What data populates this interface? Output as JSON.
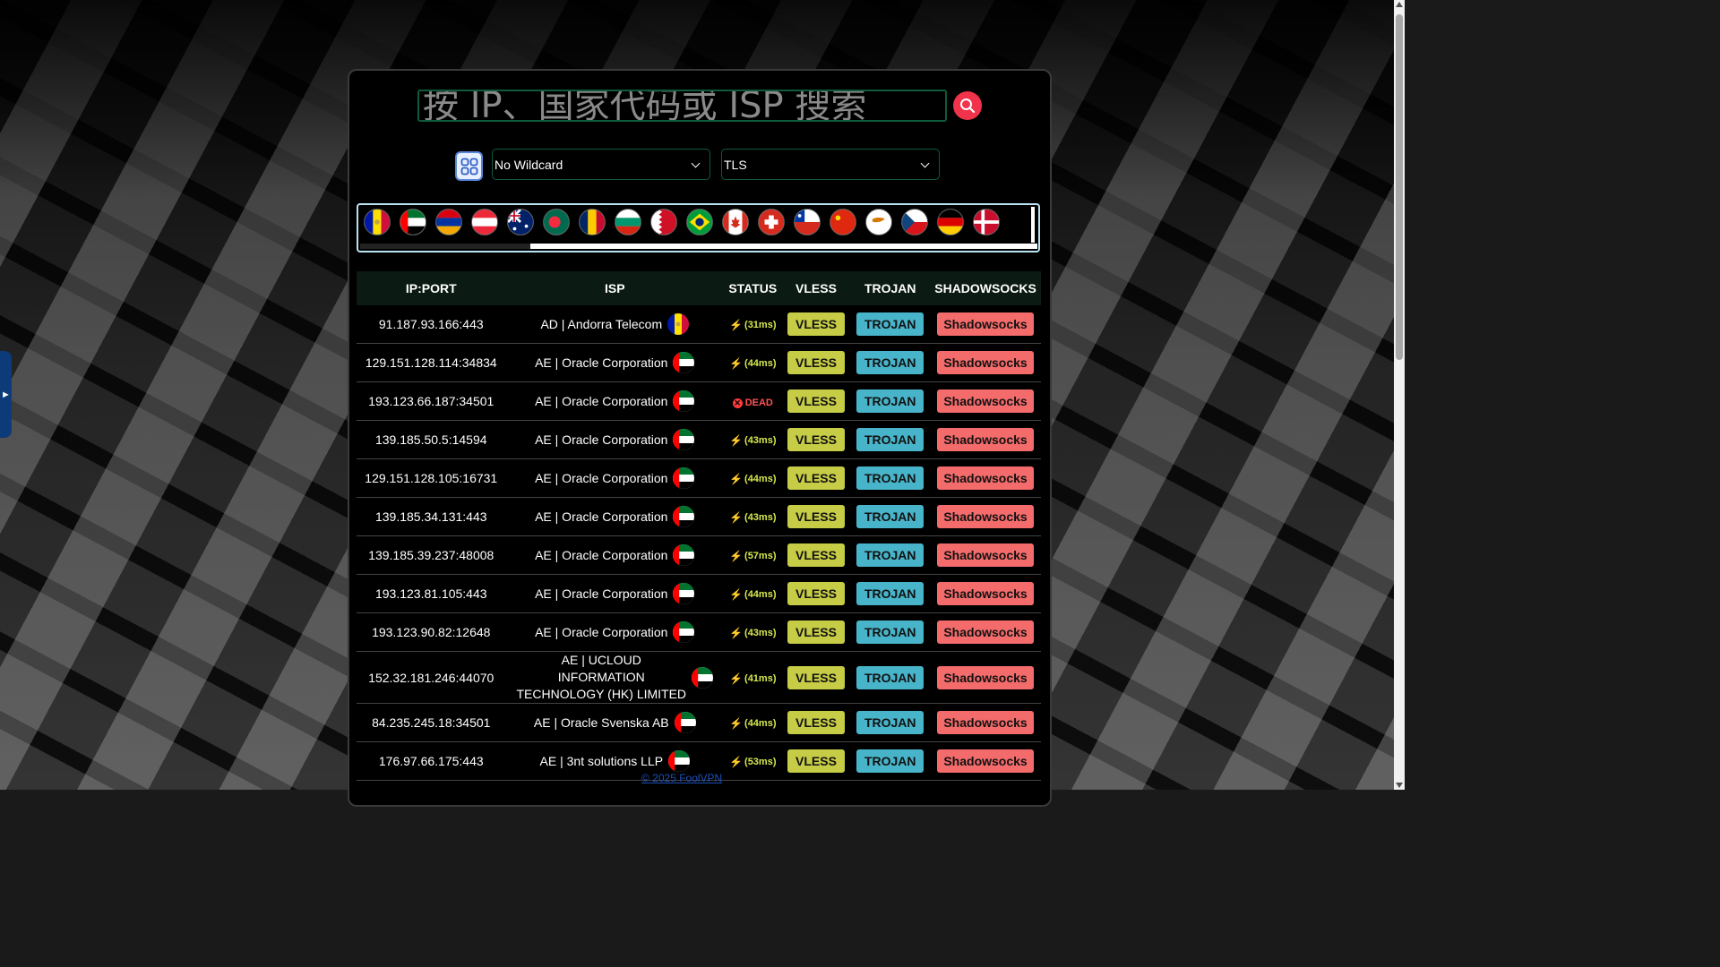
{
  "search": {
    "placeholder": "按 IP、国家代码或 ISP 搜索"
  },
  "filters": {
    "wildcard_selected": "No Wildcard",
    "tls_selected": "TLS"
  },
  "flags": [
    "AD",
    "AE",
    "AM",
    "AT",
    "AU",
    "BD",
    "TD",
    "BG",
    "BH",
    "BR",
    "CA",
    "CH",
    "CL",
    "CN",
    "CY",
    "CZ",
    "DE",
    "DK"
  ],
  "table": {
    "headers": [
      "IP:PORT",
      "ISP",
      "STATUS",
      "VLESS",
      "TROJAN",
      "SHADOWSOCKS"
    ],
    "rows": [
      {
        "ip": "91.187.93.166:443",
        "isp": "AD | Andorra Telecom",
        "flag": "AD",
        "status": "(31ms)",
        "dead": false
      },
      {
        "ip": "129.151.128.114:34834",
        "isp": "AE | Oracle Corporation",
        "flag": "AE",
        "status": "(44ms)",
        "dead": false
      },
      {
        "ip": "193.123.66.187:34501",
        "isp": "AE | Oracle Corporation",
        "flag": "AE",
        "status": "DEAD",
        "dead": true
      },
      {
        "ip": "139.185.50.5:14594",
        "isp": "AE | Oracle Corporation",
        "flag": "AE",
        "status": "(43ms)",
        "dead": false
      },
      {
        "ip": "129.151.128.105:16731",
        "isp": "AE | Oracle Corporation",
        "flag": "AE",
        "status": "(44ms)",
        "dead": false
      },
      {
        "ip": "139.185.34.131:443",
        "isp": "AE | Oracle Corporation",
        "flag": "AE",
        "status": "(43ms)",
        "dead": false
      },
      {
        "ip": "139.185.39.237:48008",
        "isp": "AE | Oracle Corporation",
        "flag": "AE",
        "status": "(57ms)",
        "dead": false
      },
      {
        "ip": "193.123.81.105:443",
        "isp": "AE | Oracle Corporation",
        "flag": "AE",
        "status": "(44ms)",
        "dead": false
      },
      {
        "ip": "193.123.90.82:12648",
        "isp": "AE | Oracle Corporation",
        "flag": "AE",
        "status": "(43ms)",
        "dead": false
      },
      {
        "ip": "152.32.181.246:44070",
        "isp": "AE | UCLOUD INFORMATION TECHNOLOGY (HK) LIMITED",
        "flag": "AE",
        "status": "(41ms)",
        "dead": false
      },
      {
        "ip": "84.235.245.18:34501",
        "isp": "AE | Oracle Svenska AB",
        "flag": "AE",
        "status": "(44ms)",
        "dead": false
      },
      {
        "ip": "176.97.66.175:443",
        "isp": "AE | 3nt solutions LLP",
        "flag": "AE",
        "status": "(53ms)",
        "dead": false
      }
    ],
    "vless_label": "VLESS",
    "trojan_label": "TROJAN",
    "ss_label": "Shadowsocks"
  },
  "side_tab_glyph": "►",
  "footer_text": "© 2025 FoolVPN"
}
